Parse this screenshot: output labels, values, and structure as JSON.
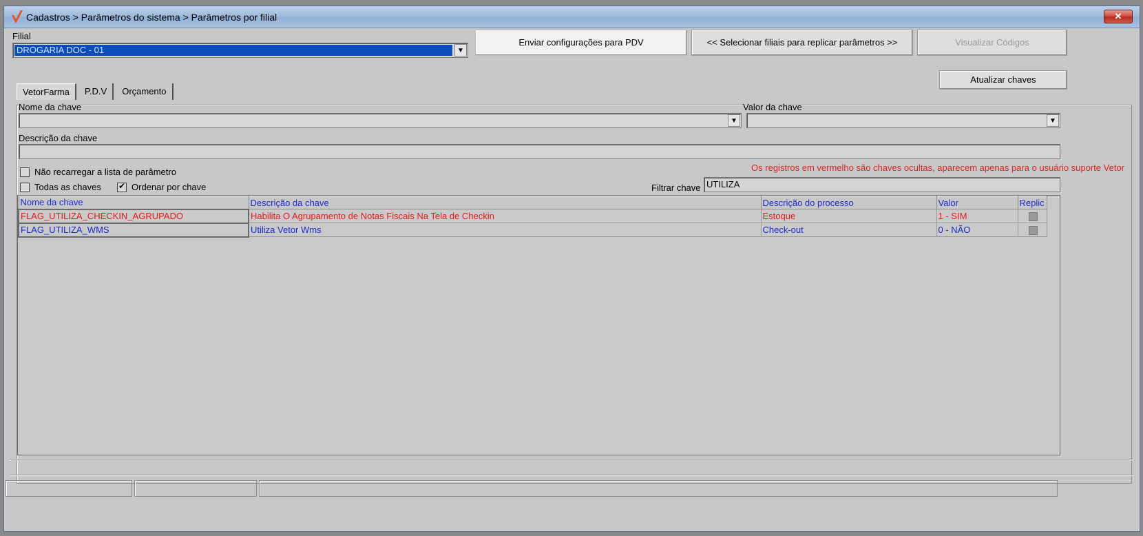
{
  "window": {
    "title": "Cadastros > Parâmetros do sistema > Parâmetros por filial",
    "close_label": "✕"
  },
  "filial": {
    "label": "Filial",
    "selected": "DROGARIA DOC - 01"
  },
  "buttons": {
    "send_pdv": "Enviar configurações para  PDV",
    "select_branches": "<< Selecionar filiais para replicar parâmetros >>",
    "view_codes": "Visualizar Códigos",
    "update_keys": "Atualizar chaves"
  },
  "tabs": [
    {
      "label": "VetorFarma",
      "active": true
    },
    {
      "label": "P.D.V",
      "active": false
    },
    {
      "label": "Orçamento",
      "active": false
    }
  ],
  "form": {
    "key_name_label": "Nome da chave",
    "key_name_value": "",
    "key_value_label": "Valor da chave",
    "key_value_value": "",
    "key_desc_label": "Descrição da chave",
    "key_desc_value": "",
    "no_reload_label": "Não recarregar a lista de parâmetro",
    "no_reload_checked": false,
    "all_keys_label": "Todas as chaves",
    "all_keys_checked": false,
    "order_by_key_label": "Ordenar por chave",
    "order_by_key_checked": true,
    "filter_label": "Filtrar chave",
    "filter_value": "UTILIZA",
    "notice": "Os registros em vermelho são chaves ocultas, aparecem apenas para o usuário suporte Vetor"
  },
  "grid": {
    "columns": [
      "Nome da chave",
      "Descrição  da chave",
      "Descrição do processo",
      "Valor",
      "Replic"
    ],
    "rows": [
      {
        "key": "FLAG_UTILIZA_CHECKIN_AGRUPADO",
        "description": "Habilita O Agrupamento de Notas Fiscais Na Tela de Checkin",
        "process": "Estoque",
        "value": "1 - SIM",
        "hidden": true
      },
      {
        "key": "FLAG_UTILIZA_WMS",
        "description": "Utiliza Vetor Wms",
        "process": "Check-out",
        "value": "0 - NÃO",
        "hidden": false
      }
    ]
  },
  "colors": {
    "hidden_row": "#e81818",
    "normal_row": "#1a2ad0",
    "selection": "#0a4fb8"
  }
}
